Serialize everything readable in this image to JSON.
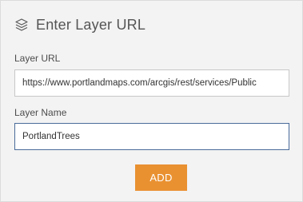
{
  "panel": {
    "title": "Enter Layer URL",
    "title_icon": "layers-icon"
  },
  "url_field": {
    "label": "Layer URL",
    "value": "https://www.portlandmaps.com/arcgis/rest/services/Public"
  },
  "name_field": {
    "label": "Layer Name",
    "value": "PortlandTrees"
  },
  "add_button": {
    "label": "ADD",
    "color": "#e99131"
  }
}
